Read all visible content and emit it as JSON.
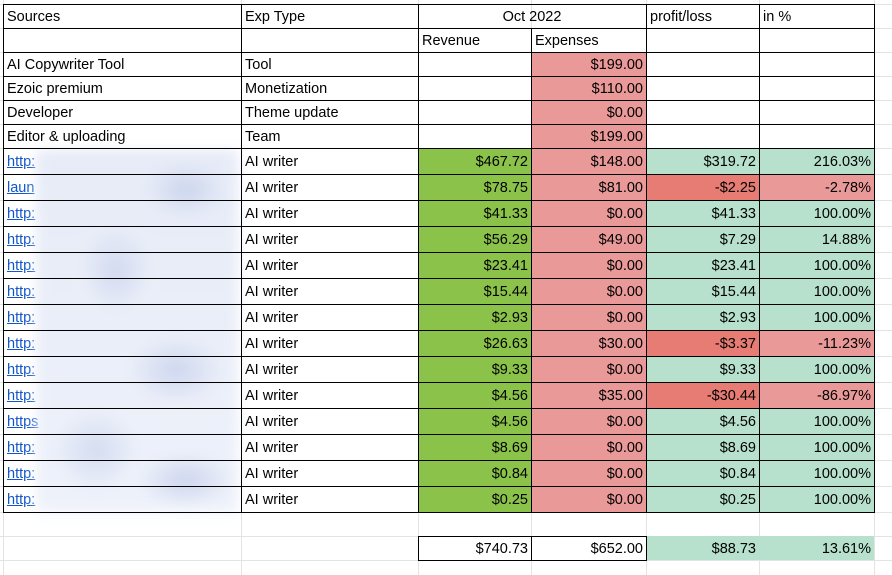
{
  "headers": {
    "sources": "Sources",
    "exp_type": "Exp Type",
    "period": "Oct 2022",
    "profit_loss": "profit/loss",
    "in_pct": "in %",
    "revenue": "Revenue",
    "expenses": "Expenses"
  },
  "expense_rows": [
    {
      "source": "AI Copywriter Tool",
      "type": "Tool",
      "expenses": "$199.00"
    },
    {
      "source": "Ezoic premium",
      "type": "Monetization",
      "expenses": "$110.00"
    },
    {
      "source": "Developer",
      "type": "Theme update",
      "expenses": "$0.00"
    },
    {
      "source": "Editor & uploading",
      "type": "Team",
      "expenses": "$199.00"
    }
  ],
  "site_rows": [
    {
      "source": "http:",
      "type": "AI writer",
      "revenue": "$467.72",
      "expenses": "$148.00",
      "profit": "$319.72",
      "pct": "216.03%",
      "status": "gain"
    },
    {
      "source": "laun",
      "type": "AI writer",
      "revenue": "$78.75",
      "expenses": "$81.00",
      "profit": "-$2.25",
      "pct": "-2.78%",
      "status": "loss"
    },
    {
      "source": "http:",
      "type": "AI writer",
      "revenue": "$41.33",
      "expenses": "$0.00",
      "profit": "$41.33",
      "pct": "100.00%",
      "status": "gain"
    },
    {
      "source": "http:",
      "type": "AI writer",
      "revenue": "$56.29",
      "expenses": "$49.00",
      "profit": "$7.29",
      "pct": "14.88%",
      "status": "gain"
    },
    {
      "source": "http:",
      "type": "AI writer",
      "revenue": "$23.41",
      "expenses": "$0.00",
      "profit": "$23.41",
      "pct": "100.00%",
      "status": "gain"
    },
    {
      "source": "http:",
      "type": "AI writer",
      "revenue": "$15.44",
      "expenses": "$0.00",
      "profit": "$15.44",
      "pct": "100.00%",
      "status": "gain"
    },
    {
      "source": "http:",
      "type": "AI writer",
      "revenue": "$2.93",
      "expenses": "$0.00",
      "profit": "$2.93",
      "pct": "100.00%",
      "status": "gain"
    },
    {
      "source": "http:",
      "type": "AI writer",
      "revenue": "$26.63",
      "expenses": "$30.00",
      "profit": "-$3.37",
      "pct": "-11.23%",
      "status": "loss"
    },
    {
      "source": "http:",
      "type": "AI writer",
      "revenue": "$9.33",
      "expenses": "$0.00",
      "profit": "$9.33",
      "pct": "100.00%",
      "status": "gain"
    },
    {
      "source": "http:",
      "type": "AI writer",
      "revenue": "$4.56",
      "expenses": "$35.00",
      "profit": "-$30.44",
      "pct": "-86.97%",
      "status": "loss"
    },
    {
      "source": "https",
      "type": "AI writer",
      "revenue": "$4.56",
      "expenses": "$0.00",
      "profit": "$4.56",
      "pct": "100.00%",
      "status": "gain"
    },
    {
      "source": "http:",
      "type": "AI writer",
      "revenue": "$8.69",
      "expenses": "$0.00",
      "profit": "$8.69",
      "pct": "100.00%",
      "status": "gain"
    },
    {
      "source": "http:",
      "type": "AI writer",
      "revenue": "$0.84",
      "expenses": "$0.00",
      "profit": "$0.84",
      "pct": "100.00%",
      "status": "gain"
    },
    {
      "source": "http:",
      "type": "AI writer",
      "revenue": "$0.25",
      "expenses": "$0.00",
      "profit": "$0.25",
      "pct": "100.00%",
      "status": "gain"
    }
  ],
  "totals": {
    "revenue": "$740.73",
    "expenses": "$652.00",
    "profit": "$88.73",
    "pct": "13.61%"
  },
  "colors": {
    "revenue_fill": "#8bc34a",
    "expenses_fill": "#ea9999",
    "profit_fill": "#b7e1cd",
    "loss_fill": "#e67c73",
    "loss_pct_fill": "#ea9999",
    "link": "#1155cc"
  }
}
